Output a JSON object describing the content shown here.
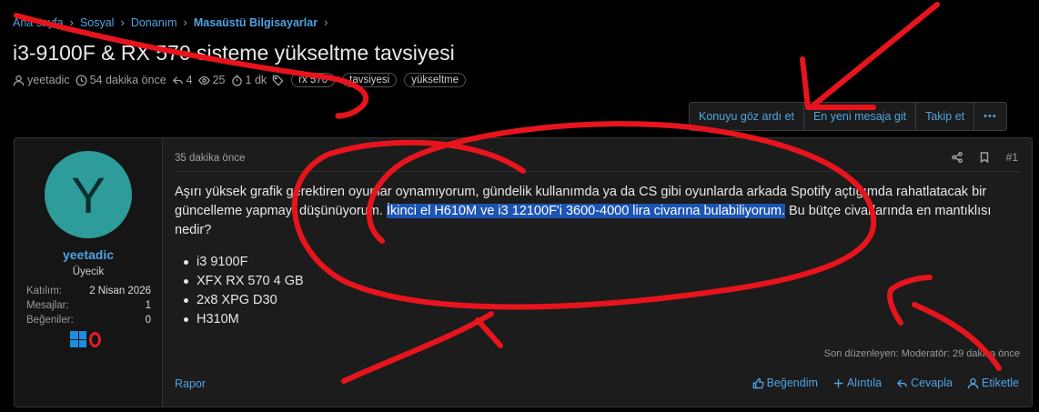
{
  "breadcrumb": {
    "items": [
      "Ana sayfa",
      "Sosyal",
      "Donanım",
      "Masaüstü Bilgisayarlar"
    ],
    "separator": "›"
  },
  "thread": {
    "title": "i3-9100F & RX 570 sisteme yükseltme tavsiyesi",
    "author": "yeetadic",
    "time": "54 dakika önce",
    "replies": "4",
    "views": "25",
    "read_time": "1 dk",
    "tags": [
      "rx 570",
      "tavsiyesi",
      "yükseltme"
    ]
  },
  "actions": {
    "ignore": "Konuyu göz ardı et",
    "newest": "En yeni mesaja git",
    "follow": "Takip et",
    "more": "•••"
  },
  "user": {
    "avatar_letter": "Y",
    "avatar_color": "#2d9c9b",
    "name": "yeetadic",
    "title": "Üyecik",
    "stats": [
      {
        "k": "Katılım:",
        "v": "2 Nisan 2026"
      },
      {
        "k": "Mesajlar:",
        "v": "1"
      },
      {
        "k": "Beğeniler:",
        "v": "0"
      }
    ],
    "badges": [
      "windows-icon",
      "opera-icon"
    ]
  },
  "post": {
    "time": "35 dakika önce",
    "number": "#1",
    "text_before": "Aşırı yüksek grafik gerektiren oyunlar oynamıyorum, gündelik kullanımda ya da CS gibi oyunlarda arkada Spotify açtığımda rahatlatacak bir güncelleme yapmayı düşünüyorum. ",
    "text_highlight": "İkinci el H610M ve i3 12100F'i 3600-4000 lira civarına bulabiliyorum.",
    "text_after": " Bu bütçe civarlarında en mantıklısı nedir?",
    "specs": [
      "i3 9100F",
      "XFX RX 570 4 GB",
      "2x8 XPG D30",
      "H310M"
    ],
    "edited": "Son düzenleyen: Moderatör: 29 dakika önce",
    "report": "Rapor",
    "like": "Beğendim",
    "quote": "Alıntıla",
    "reply": "Cevapla",
    "tag": "Etiketle"
  },
  "colors": {
    "accent": "#4fa3e3",
    "highlight": "#1c54b3",
    "annotation": "#e8141d"
  }
}
